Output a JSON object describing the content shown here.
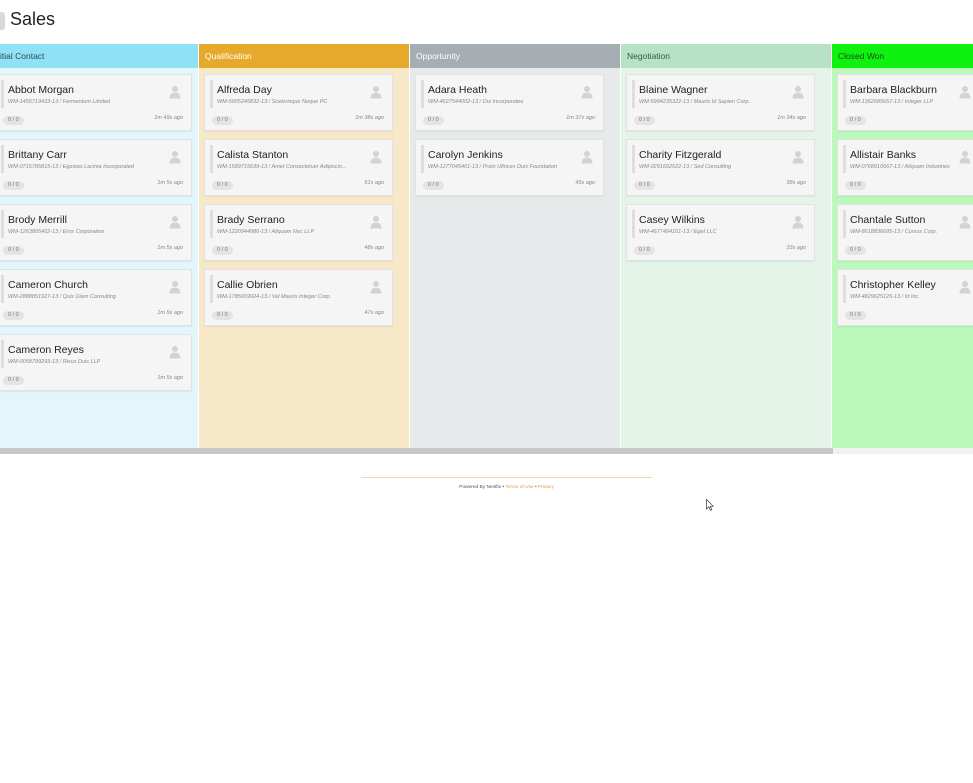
{
  "page": {
    "title": "Sales"
  },
  "columns": [
    {
      "label": "itial Contact",
      "cards": [
        {
          "name": "Abbot Morgan",
          "sub": "WM-1455719433-13 / Fermentum Limited",
          "badge": "0 / 0",
          "time": "1m 49s ago"
        },
        {
          "name": "Brittany Carr",
          "sub": "WM-0715785815-13 / Egestas Lacinia Incorporated",
          "badge": "0 / 0",
          "time": "1m 5s ago"
        },
        {
          "name": "Brody Merrill",
          "sub": "WM-1263805402-13 / Eros Corporation",
          "badge": "0 / 0",
          "time": "1m 5s ago"
        },
        {
          "name": "Cameron Church",
          "sub": "WM-2888851927-13 / Quis Diam Consulting",
          "badge": "0 / 0",
          "time": "1m 5s ago"
        },
        {
          "name": "Cameron Reyes",
          "sub": "WM-0058799293-13 / Risus Duis LLP",
          "badge": "0 / 0",
          "time": "1m 5s ago"
        }
      ]
    },
    {
      "label": "Qualification",
      "cards": [
        {
          "name": "Alfreda Day",
          "sub": "WM-5905245832-13 / Scelerisque Neque PC",
          "badge": "0 / 0",
          "time": "1m 38s ago"
        },
        {
          "name": "Calista Stanton",
          "sub": "WM-1589715639-13 / Amet Consectetuer Adipiscin...",
          "badge": "0 / 0",
          "time": "51s ago"
        },
        {
          "name": "Brady Serrano",
          "sub": "WM-1220944986-13 / Aliquam Nec LLP",
          "badge": "0 / 0",
          "time": "48s ago"
        },
        {
          "name": "Callie Obrien",
          "sub": "WM-1785659924-13 / Vel Mauris Integer Corp.",
          "badge": "0 / 0",
          "time": "47s ago"
        }
      ]
    },
    {
      "label": "Opportunity",
      "cards": [
        {
          "name": "Adara Heath",
          "sub": "WM-4627544002-13 / Dui Incorporated",
          "badge": "0 / 0",
          "time": "1m 37s ago"
        },
        {
          "name": "Carolyn Jenkins",
          "sub": "WM-1277045401-13 / Proin Ultrices Duis Foundation",
          "badge": "0 / 0",
          "time": "45s ago"
        }
      ]
    },
    {
      "label": "Negotiation",
      "cards": [
        {
          "name": "Blaine Wagner",
          "sub": "WM-5994235322-13 / Mauris Id Sapien Corp.",
          "badge": "0 / 0",
          "time": "1m 34s ago"
        },
        {
          "name": "Charity Fitzgerald",
          "sub": "WM-0291692622-13 / Sed Consulting",
          "badge": "0 / 0",
          "time": "38s ago"
        },
        {
          "name": "Casey Wilkins",
          "sub": "WM-4677494161-13 / Eget LLC",
          "badge": "0 / 0",
          "time": "33s ago"
        }
      ]
    },
    {
      "label": "Closed Won",
      "cards": [
        {
          "name": "Barbara Blackburn",
          "sub": "WM-1362685657-13 / Integer LLP",
          "badge": "0 / 0",
          "time": ""
        },
        {
          "name": "Allistair Banks",
          "sub": "WM-0768910667-13 / Aliquam Industries",
          "badge": "0 / 0",
          "time": ""
        },
        {
          "name": "Chantale Sutton",
          "sub": "WM-8618836695-13 / Cursus Corp.",
          "badge": "0 / 0",
          "time": ""
        },
        {
          "name": "Christopher Kelley",
          "sub": "WM-4829625125-13 / Id Inc.",
          "badge": "0 / 0",
          "time": ""
        }
      ]
    }
  ],
  "footer": {
    "powered": "Powered By Nestfix",
    "sep1": " • ",
    "terms": "Terms of Use",
    "sep2": " • ",
    "privacy": "Privacy"
  },
  "colors": {
    "initial_contact": "#8fe1f5",
    "qualification": "#e6a92c",
    "opportunity": "#a6aeb4",
    "negotiation": "#b7e2c5",
    "closed_won": "#0ff20f",
    "footer_link": "#e8954a"
  },
  "icons": {
    "card_avatar": "person-icon"
  }
}
